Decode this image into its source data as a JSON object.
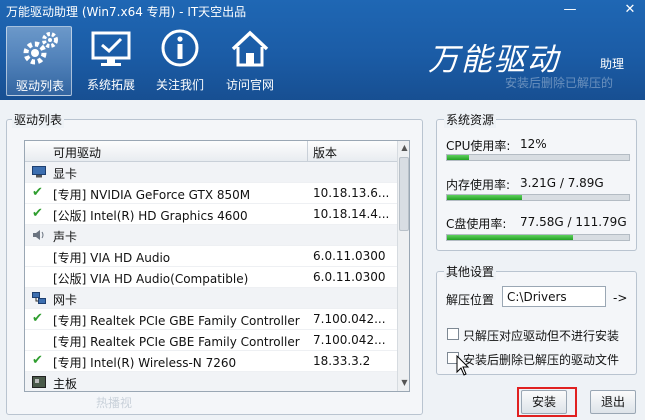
{
  "window": {
    "title": "万能驱动助理 (Win7.x64 专用) - IT天空出品",
    "min_glyph": "—",
    "close_glyph": "✕"
  },
  "toolbar": {
    "items": [
      {
        "label": "驱动列表",
        "icon": "gears-icon",
        "active": true
      },
      {
        "label": "系统拓展",
        "icon": "monitor-check-icon",
        "active": false
      },
      {
        "label": "关注我们",
        "icon": "info-icon",
        "active": false
      },
      {
        "label": "访问官网",
        "icon": "home-icon",
        "active": false
      }
    ]
  },
  "brand": {
    "main": "万能驱动",
    "sub": "助理",
    "ghost_text_1": "安装后删除已解压的",
    "ghost_text_2": "热播视"
  },
  "driver_panel": {
    "title": "驱动列表",
    "columns": {
      "name": "可用驱动",
      "version": "版本"
    },
    "rows": [
      {
        "type": "category",
        "name": "显卡",
        "icon": "display-adapter-icon"
      },
      {
        "type": "driver",
        "checked": true,
        "name": "[专用] NVIDIA GeForce GTX 850M",
        "version": "10.18.13.6..."
      },
      {
        "type": "driver",
        "checked": true,
        "name": "[公版] Intel(R) HD Graphics 4600",
        "version": "10.18.14.4..."
      },
      {
        "type": "category",
        "name": "声卡",
        "icon": "speaker-icon"
      },
      {
        "type": "driver",
        "checked": false,
        "name": "[专用] VIA HD Audio",
        "version": "6.0.11.0300"
      },
      {
        "type": "driver",
        "checked": false,
        "name": "[公版] VIA HD Audio(Compatible)",
        "version": "6.0.11.0300"
      },
      {
        "type": "category",
        "name": "网卡",
        "icon": "network-icon"
      },
      {
        "type": "driver",
        "checked": true,
        "name": "[专用] Realtek PCIe GBE Family Controller",
        "version": "7.100.042..."
      },
      {
        "type": "driver",
        "checked": false,
        "name": "[专用] Realtek PCIe GBE Family Controller",
        "version": "7.100.042..."
      },
      {
        "type": "driver",
        "checked": true,
        "name": "[专用] Intel(R) Wireless-N 7260",
        "version": "18.33.3.2"
      },
      {
        "type": "category",
        "name": "主板",
        "icon": "motherboard-icon"
      }
    ]
  },
  "resources": {
    "title": "系统资源",
    "cpu": {
      "label": "CPU使用率:",
      "value": "12%",
      "fraction": 0.12
    },
    "memory": {
      "label": "内存使用率:",
      "value": "3.21G / 7.89G",
      "fraction": 0.41
    },
    "disk": {
      "label": "C盘使用率:",
      "value": "77.58G / 111.79G",
      "fraction": 0.69
    }
  },
  "settings": {
    "title": "其他设置",
    "extract_label": "解压位置",
    "extract_value": "C:\\Drivers",
    "browse_label": "->",
    "option1": {
      "label": "只解压对应驱动但不进行安装",
      "checked": false
    },
    "option2": {
      "label": "安装后删除已解压的驱动文件",
      "checked": false
    }
  },
  "actions": {
    "install_label": "安装",
    "exit_label": "退出"
  },
  "colors": {
    "titlebar": "#1b5ca6",
    "check_green": "#2f9e2f",
    "bar_green": "#23a123",
    "highlight_red": "#e02020"
  }
}
